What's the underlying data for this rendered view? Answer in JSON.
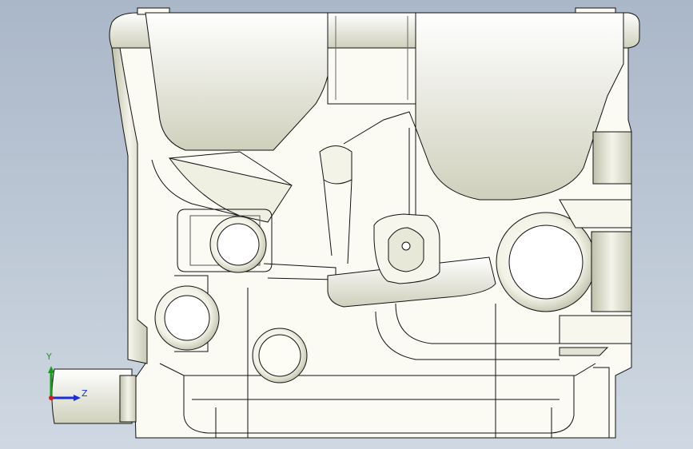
{
  "triad": {
    "axes": {
      "y": {
        "label": "Y",
        "color": "#1a9a1a"
      },
      "z": {
        "label": "Z",
        "color": "#1a2fd8"
      },
      "x": {
        "color": "#d41c1c"
      }
    }
  },
  "colors": {
    "background_top": "#aab7c8",
    "background_bottom": "#cfd8e2",
    "part_fill": "#fbfbf4",
    "part_shade": "#c6c7b2",
    "edge": "#111111"
  }
}
